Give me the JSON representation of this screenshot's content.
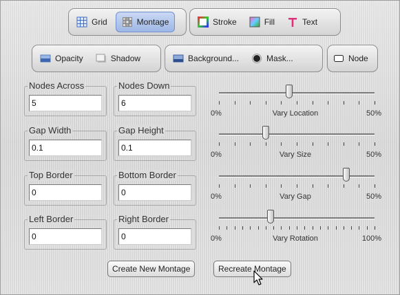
{
  "toolbar": {
    "row1": {
      "grid": "Grid",
      "montage": "Montage",
      "stroke": "Stroke",
      "fill": "Fill",
      "text": "Text"
    },
    "row2": {
      "opacity": "Opacity",
      "shadow": "Shadow",
      "background": "Background...",
      "mask": "Mask...",
      "node": "Node"
    },
    "active_tab": "Montage"
  },
  "fields": [
    {
      "label": "Nodes Across",
      "value": "5"
    },
    {
      "label": "Nodes Down",
      "value": "6"
    },
    {
      "label": "Gap Width",
      "value": "0.1"
    },
    {
      "label": "Gap Height",
      "value": "0.1"
    },
    {
      "label": "Top Border",
      "value": "0"
    },
    {
      "label": "Bottom Border",
      "value": "0"
    },
    {
      "label": "Left Border",
      "value": "0"
    },
    {
      "label": "Right Border",
      "value": "0"
    }
  ],
  "sliders": [
    {
      "label": "Vary Location",
      "min": "0%",
      "max": "50%",
      "position": 0.45,
      "ticks": 11
    },
    {
      "label": "Vary Size",
      "min": "0%",
      "max": "50%",
      "position": 0.3,
      "ticks": 11
    },
    {
      "label": "Vary Gap",
      "min": "0%",
      "max": "50%",
      "position": 0.82,
      "ticks": 11
    },
    {
      "label": "Vary Rotation",
      "min": "0%",
      "max": "100%",
      "position": 0.33,
      "ticks": 21
    }
  ],
  "buttons": {
    "create": "Create New Montage",
    "recreate": "Recreate Montage"
  }
}
